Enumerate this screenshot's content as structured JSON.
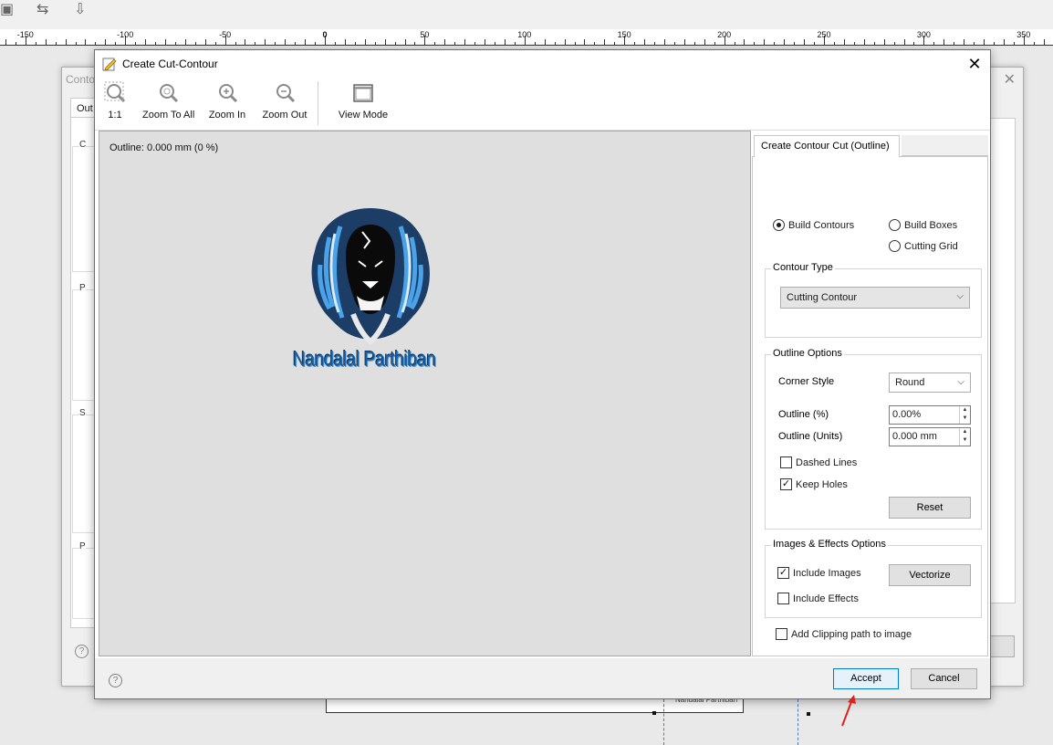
{
  "ruler": {
    "labels": [
      "-150",
      "-100",
      "-50",
      "0",
      "50",
      "100",
      "150",
      "200",
      "250",
      "300",
      "350"
    ]
  },
  "background_dialog": {
    "title": "Conto",
    "tab": "Out",
    "group_labels": [
      "C",
      "P",
      "S",
      "P"
    ]
  },
  "dialog": {
    "title": "Create Cut-Contour",
    "close": "✕",
    "toolbar": {
      "one_to_one": "1:1",
      "zoom_to_all": "Zoom To All",
      "zoom_in": "Zoom In",
      "zoom_out": "Zoom Out",
      "view_mode": "View Mode"
    },
    "preview": {
      "status": "Outline: 0.000 mm (0 %)",
      "logo_text": "Nandalal Parthiban"
    },
    "settings": {
      "tab": "Create Contour Cut (Outline)",
      "radios": {
        "build_contours": "Build Contours",
        "build_boxes": "Build Boxes",
        "cutting_grid": "Cutting Grid"
      },
      "contour_type": {
        "label": "Contour Type",
        "value": "Cutting Contour"
      },
      "outline_options": {
        "label": "Outline Options",
        "corner_style_label": "Corner Style",
        "corner_style_value": "Round",
        "outline_pct_label": "Outline (%)",
        "outline_pct_value": "0.00%",
        "outline_units_label": "Outline (Units)",
        "outline_units_value": "0.000 mm",
        "dashed_lines": "Dashed Lines",
        "keep_holes": "Keep Holes",
        "reset": "Reset"
      },
      "images_effects": {
        "label": "Images & Effects Options",
        "include_images": "Include Images",
        "include_effects": "Include Effects",
        "vectorize": "Vectorize"
      },
      "clipping_path": "Add Clipping path to image"
    },
    "footer": {
      "help": "?",
      "accept": "Accept",
      "cancel": "Cancel"
    }
  },
  "artboard": {
    "text": "Nandalal Parthiban"
  },
  "state": {
    "build_contours_selected": true,
    "dashed_lines_checked": false,
    "keep_holes_checked": true,
    "include_images_checked": true,
    "include_effects_checked": false,
    "clipping_path_checked": false
  },
  "colors": {
    "logo_blue": "#1a5fa0",
    "accent": "#0078d7",
    "annotation_arrow": "#e0201e"
  }
}
